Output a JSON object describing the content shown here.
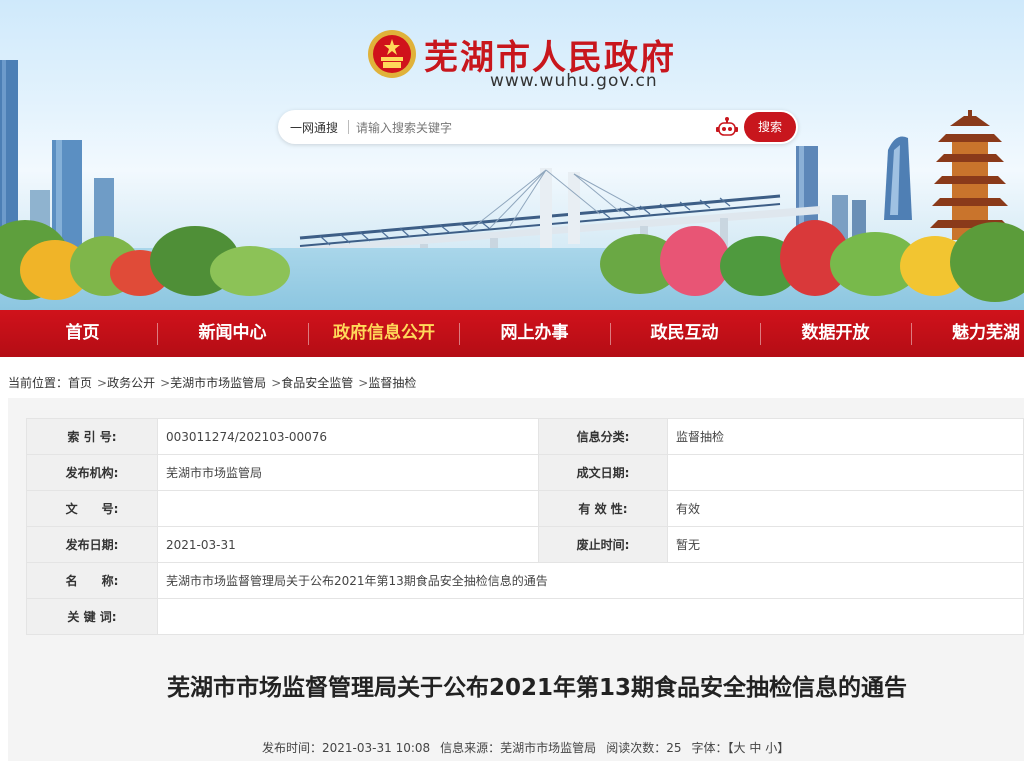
{
  "site": {
    "title": "芜湖市人民政府",
    "url": "www.wuhu.gov.cn"
  },
  "search": {
    "scope_label": "一网通搜",
    "placeholder": "请输入搜索关键字",
    "button_label": "搜索"
  },
  "nav": {
    "items": [
      {
        "label": "首页"
      },
      {
        "label": "新闻中心"
      },
      {
        "label": "政府信息公开"
      },
      {
        "label": "网上办事"
      },
      {
        "label": "政民互动"
      },
      {
        "label": "数据开放"
      },
      {
        "label": "魅力芜湖"
      }
    ],
    "active_index": 2
  },
  "breadcrumb": {
    "prefix": "当前位置：",
    "items": [
      "首页",
      "政务公开",
      "芜湖市市场监管局",
      "食品安全监管",
      "监督抽检"
    ]
  },
  "info": {
    "index_label": "索 引 号:",
    "index_value": "003011274/202103-00076",
    "category_label": "信息分类:",
    "category_value": "监督抽检",
    "publisher_label": "发布机构:",
    "publisher_value": "芜湖市市场监管局",
    "created_label": "成文日期:",
    "created_value": "",
    "doc_no_label": "文　　号:",
    "doc_no_value": "",
    "validity_label": "有 效 性:",
    "validity_value": "有效",
    "pub_date_label": "发布日期:",
    "pub_date_value": "2021-03-31",
    "abolish_label": "废止时间:",
    "abolish_value": "暂无",
    "name_label": "名　　称:",
    "name_value": "芜湖市市场监督管理局关于公布2021年第13期食品安全抽检信息的通告",
    "keyword_label": "关 键 词:",
    "keyword_value": ""
  },
  "article": {
    "title": "芜湖市市场监督管理局关于公布2021年第13期食品安全抽检信息的通告",
    "time_label": "发布时间：",
    "time_value": "2021-03-31 10:08",
    "source_label": "信息来源：",
    "source_value": "芜湖市市场监管局",
    "views_label": "阅读次数：",
    "views_value": "25",
    "font_label": "字体：",
    "font_open": "【",
    "font_large": "大",
    "font_medium": "中",
    "font_small": "小",
    "font_close": "】"
  },
  "colors": {
    "brand_red": "#c8161d",
    "nav_active": "#ffd95a"
  }
}
